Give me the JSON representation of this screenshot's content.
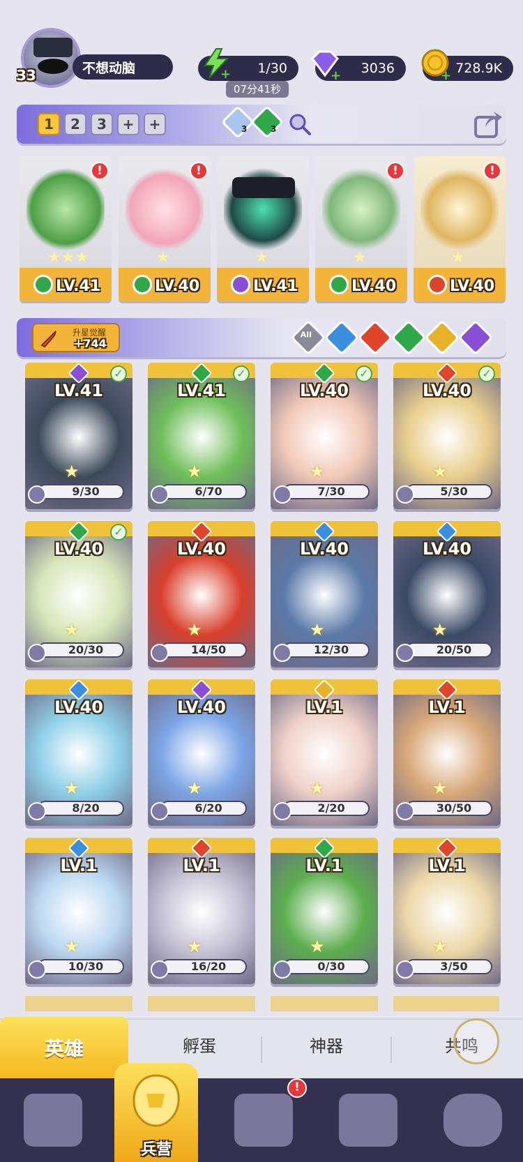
{
  "player": {
    "level": "33",
    "name": "不想动脑"
  },
  "resources": {
    "energy": "1/30",
    "energy_timer": "07分41秒",
    "gems": "3036",
    "gold": "728.9K"
  },
  "team_tabs": [
    "1",
    "2",
    "3",
    "+",
    "+"
  ],
  "team_center": {
    "crystal_count": "3",
    "leaf_count": "3"
  },
  "team": [
    {
      "level": "LV.41",
      "element_color": "#2fa84a",
      "alert": "!"
    },
    {
      "level": "LV.40",
      "element_color": "#2fa84a",
      "alert": "!"
    },
    {
      "level": "LV.41",
      "element_color": "#8a4fd6",
      "alert": ""
    },
    {
      "level": "LV.40",
      "element_color": "#2fa84a",
      "alert": "!"
    },
    {
      "level": "LV.40",
      "element_color": "#e0442b",
      "alert": "!"
    }
  ],
  "awaken": {
    "label": "升星觉醒",
    "value": "+744"
  },
  "filters": [
    {
      "label": "All",
      "color": "#8a8a98"
    },
    {
      "label": "",
      "color": "#3a8fe0"
    },
    {
      "label": "",
      "color": "#e0442b"
    },
    {
      "label": "",
      "color": "#2fa84a"
    },
    {
      "label": "",
      "color": "#e7b22a"
    },
    {
      "label": "",
      "color": "#8a4fd6"
    }
  ],
  "heroes": [
    {
      "level": "LV.41",
      "progress": "9/30",
      "element": "#8a4fd6",
      "check": "✓",
      "art": "#3c4a5a"
    },
    {
      "level": "LV.41",
      "progress": "6/70",
      "element": "#2fa84a",
      "check": "✓",
      "art": "#6fbf5a"
    },
    {
      "level": "LV.40",
      "progress": "7/30",
      "element": "#2fa84a",
      "check": "✓",
      "art": "#f2c9b8"
    },
    {
      "level": "LV.40",
      "progress": "5/30",
      "element": "#e0442b",
      "check": "✓",
      "art": "#e9cf8c"
    },
    {
      "level": "LV.40",
      "progress": "20/30",
      "element": "#2fa84a",
      "check": "✓",
      "art": "#d7e6b8"
    },
    {
      "level": "LV.40",
      "progress": "14/50",
      "element": "#e0442b",
      "check": "",
      "art": "#d8402c"
    },
    {
      "level": "LV.40",
      "progress": "12/30",
      "element": "#3a8fe0",
      "check": "",
      "art": "#5a7aa8"
    },
    {
      "level": "LV.40",
      "progress": "20/50",
      "element": "#3a8fe0",
      "check": "",
      "art": "#3a4a66"
    },
    {
      "level": "LV.40",
      "progress": "8/20",
      "element": "#3a8fe0",
      "check": "",
      "art": "#8fd0e8"
    },
    {
      "level": "LV.40",
      "progress": "6/20",
      "element": "#8a4fd6",
      "check": "",
      "art": "#7ca6e6"
    },
    {
      "level": "LV.1",
      "progress": "2/20",
      "element": "#e7b22a",
      "check": "",
      "art": "#f0d2c8"
    },
    {
      "level": "LV.1",
      "progress": "30/50",
      "element": "#e0442b",
      "check": "",
      "art": "#d8a878"
    },
    {
      "level": "LV.1",
      "progress": "10/30",
      "element": "#3a8fe0",
      "check": "",
      "art": "#bcd8f2"
    },
    {
      "level": "LV.1",
      "progress": "16/20",
      "element": "#e0442b",
      "check": "",
      "art": "#c7c3d6"
    },
    {
      "level": "LV.1",
      "progress": "0/30",
      "element": "#2fa84a",
      "check": "",
      "art": "#5cae4e"
    },
    {
      "level": "LV.1",
      "progress": "3/50",
      "element": "#e0442b",
      "check": "",
      "art": "#ecd8a8"
    }
  ],
  "subtabs": [
    "英雄",
    "孵蛋",
    "神器",
    "共鸣"
  ],
  "nav": {
    "barracks_label": "兵营",
    "alert": "!"
  }
}
